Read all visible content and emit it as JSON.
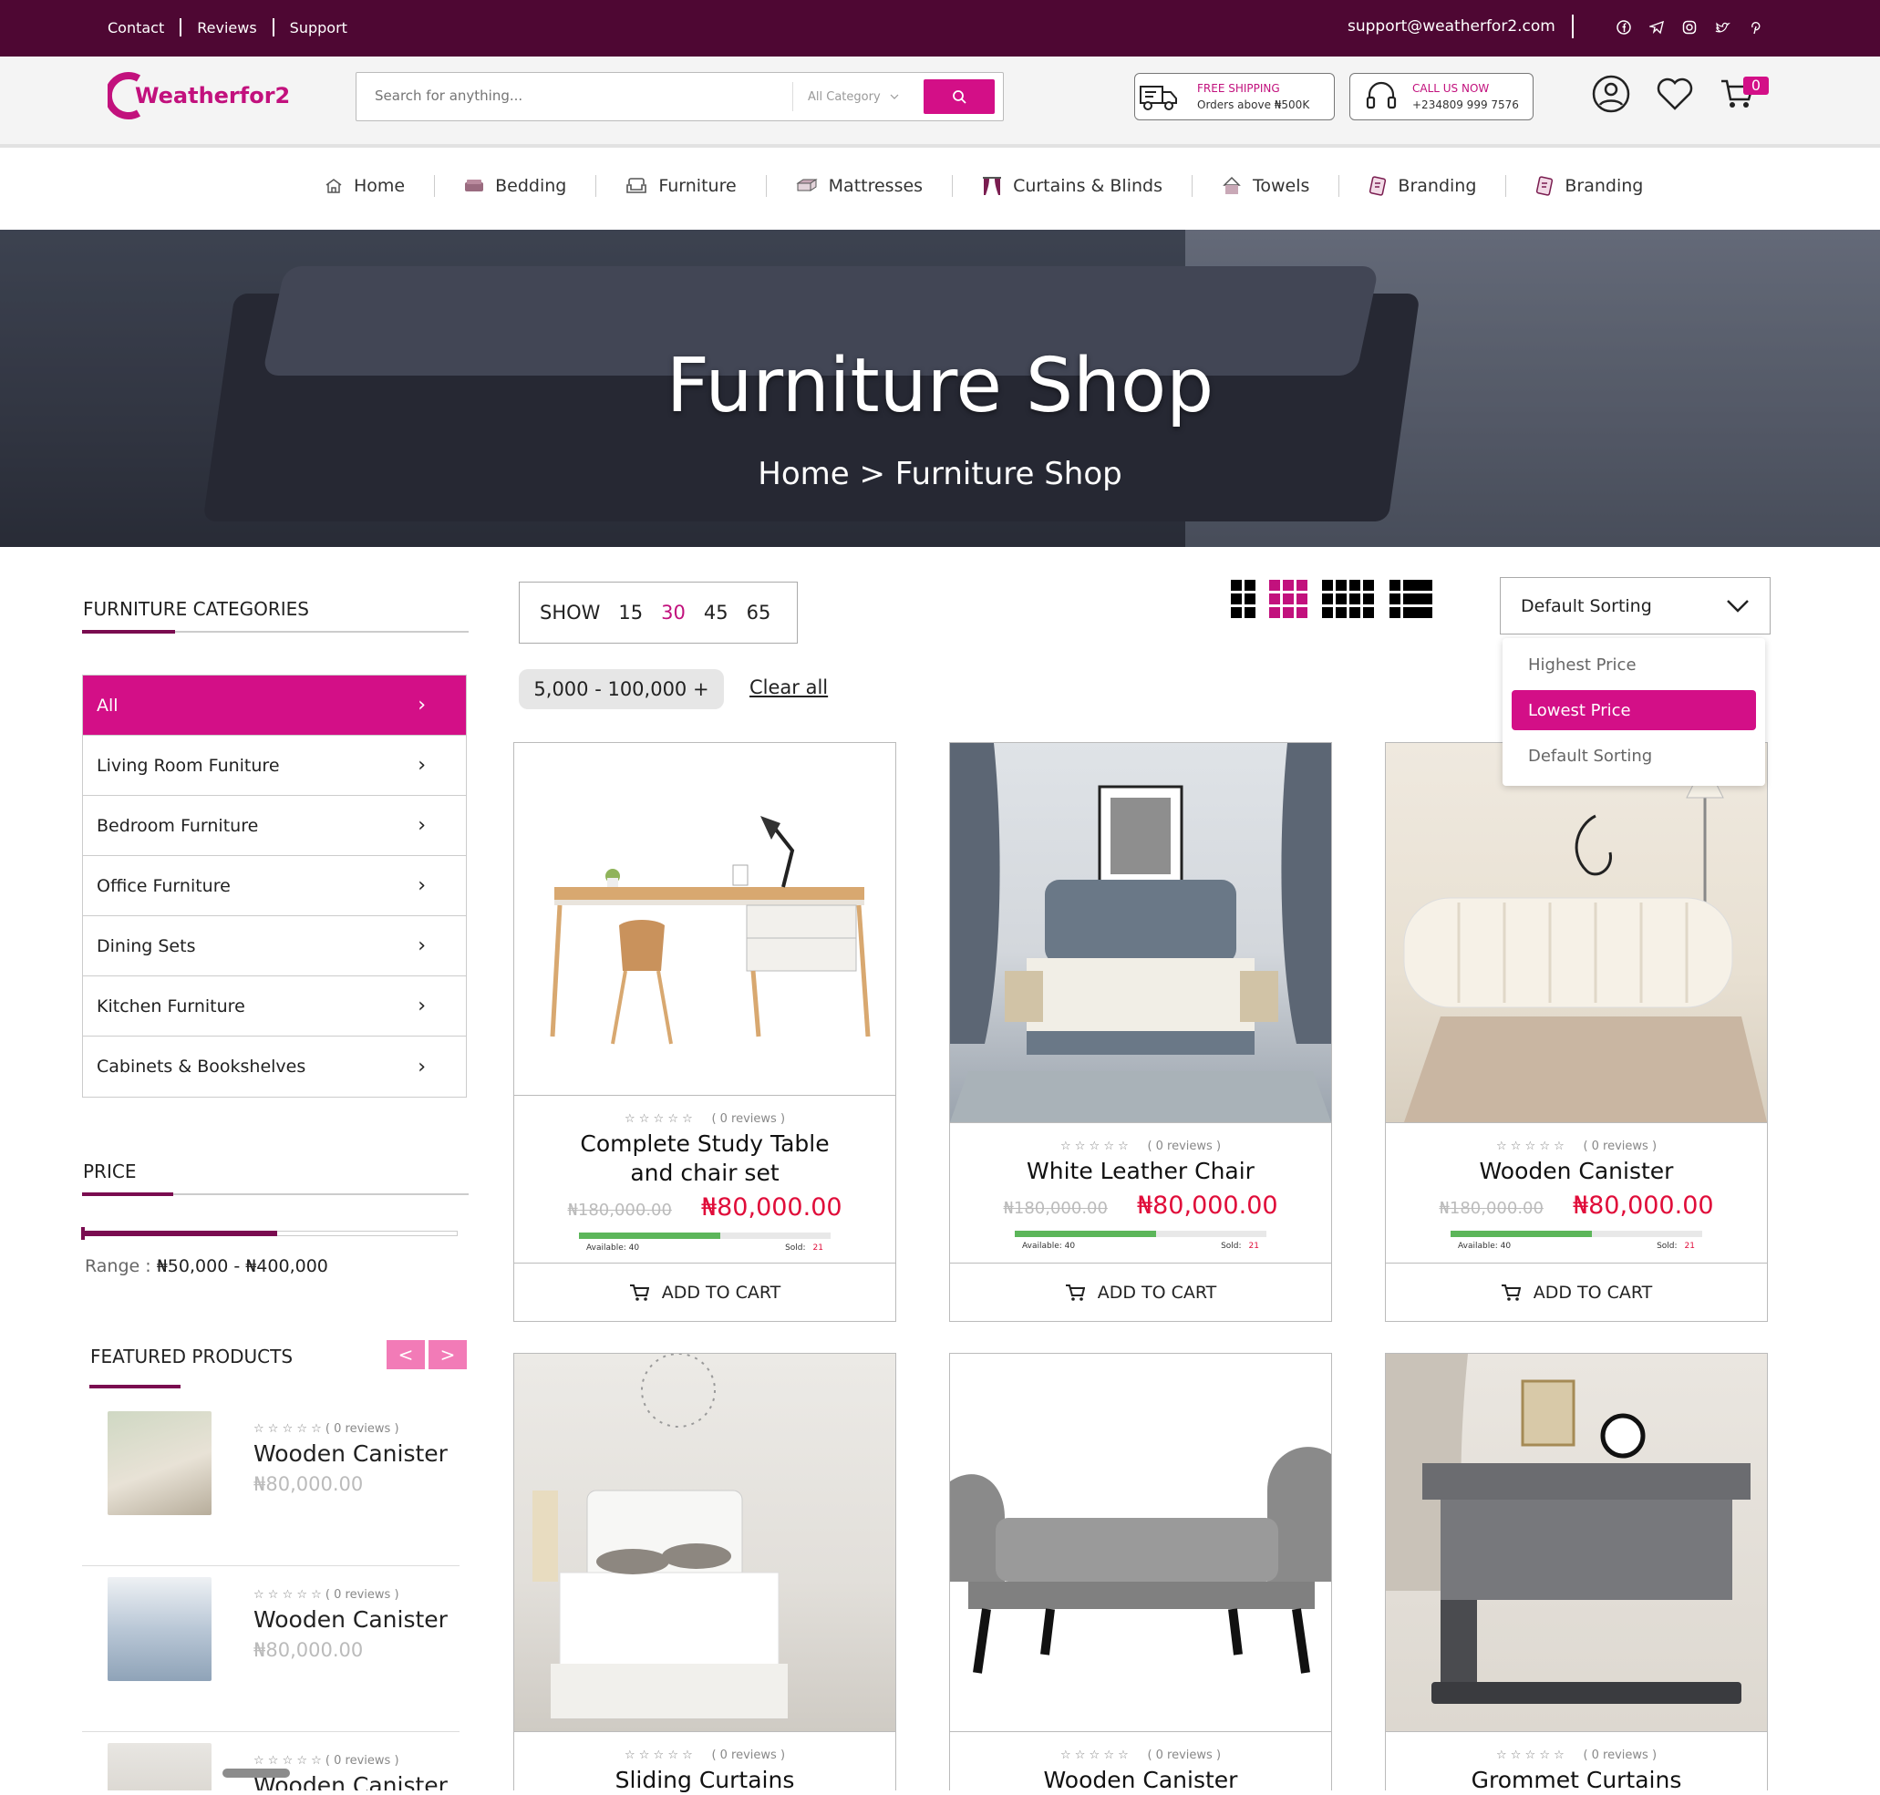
{
  "topbar": {
    "links": [
      "Contact",
      "Reviews",
      "Support"
    ],
    "email": "support@weatherfor2.com",
    "socials": [
      "facebook-icon",
      "telegram-icon",
      "instagram-icon",
      "twitter-icon",
      "pinterest-icon"
    ]
  },
  "header": {
    "logo": "Weatherfor2",
    "search_placeholder": "Search for anything...",
    "category": "All Category",
    "shipping": {
      "title": "FREE SHIPPING",
      "subtitle": "Orders above ₦500K"
    },
    "call": {
      "title": "CALL US NOW",
      "subtitle": "+234809 999 7576"
    },
    "cart_count": "0"
  },
  "nav": [
    {
      "label": "Home",
      "icon": "home-icon"
    },
    {
      "label": "Bedding",
      "icon": "bedding-icon"
    },
    {
      "label": "Furniture",
      "icon": "sofa-icon"
    },
    {
      "label": "Mattresses",
      "icon": "mattress-icon"
    },
    {
      "label": "Curtains & Blinds",
      "icon": "curtain-icon"
    },
    {
      "label": "Towels",
      "icon": "towel-icon"
    },
    {
      "label": "Branding",
      "icon": "branding-icon"
    },
    {
      "label": "Branding",
      "icon": "branding-icon"
    }
  ],
  "hero": {
    "title": "Furniture Shop",
    "breadcrumb": "Home > Furniture Shop"
  },
  "sidebar": {
    "categories_title": "FURNITURE CATEGORIES",
    "categories": [
      "All",
      "Living Room Funiture",
      "Bedroom Furniture",
      "Office Furniture",
      "Dining Sets",
      "Kitchen Furniture",
      "Cabinets & Bookshelves"
    ],
    "price_title": "PRICE",
    "price_fill_fraction": 0.52,
    "range_label": "Range :",
    "range_value": "₦50,000 - ₦400,000",
    "featured_title": "FEATURED PRODUCTS",
    "featured_prev": "<",
    "featured_next": ">",
    "featured": [
      {
        "stars": "☆ ☆ ☆ ☆ ☆ ( 0 reviews )",
        "name": "Wooden Canister",
        "price": "₦80,000.00"
      },
      {
        "stars": "☆ ☆ ☆ ☆ ☆ ( 0 reviews )",
        "name": "Wooden Canister",
        "price": "₦80,000.00"
      },
      {
        "stars": "☆ ☆ ☆ ☆ ☆ ( 0 reviews )",
        "name": "Wooden Canister",
        "price": ""
      }
    ]
  },
  "toolbar": {
    "show_label": "SHOW",
    "show_options": [
      "15",
      "30",
      "45",
      "65"
    ],
    "show_selected": "30",
    "filter_chip": "5,000 - 100,000 +",
    "clear_all": "Clear all",
    "sort_selected": "Default Sorting",
    "sort_options": [
      "Highest Price",
      "Lowest Price",
      "Default Sorting"
    ],
    "sort_highlighted": "Lowest Price"
  },
  "products": [
    {
      "stars": "☆ ☆ ☆ ☆ ☆",
      "reviews": "( 0 reviews )",
      "name": "Complete Study Table and chair set",
      "old_price": "₦180,000.00",
      "price": "₦80,000.00",
      "available_label": "Available:",
      "available": "40",
      "sold_label": "Sold:",
      "sold": "21",
      "stock_fraction": 0.56,
      "cart": "ADD TO CART"
    },
    {
      "stars": "☆ ☆ ☆ ☆ ☆",
      "reviews": "( 0 reviews )",
      "name": "White Leather Chair",
      "old_price": "₦180,000.00",
      "price": "₦80,000.00",
      "available_label": "Available:",
      "available": "40",
      "sold_label": "Sold:",
      "sold": "21",
      "stock_fraction": 0.56,
      "cart": "ADD TO CART"
    },
    {
      "stars": "☆ ☆ ☆ ☆ ☆",
      "reviews": "( 0 reviews )",
      "name": "Wooden Canister",
      "old_price": "₦180,000.00",
      "price": "₦80,000.00",
      "available_label": "Available:",
      "available": "40",
      "sold_label": "Sold:",
      "sold": "21",
      "stock_fraction": 0.56,
      "cart": "ADD TO CART"
    },
    {
      "stars": "☆ ☆ ☆ ☆ ☆",
      "reviews": "( 0 reviews )",
      "name": "Sliding Curtains"
    },
    {
      "stars": "☆ ☆ ☆ ☆ ☆",
      "reviews": "( 0 reviews )",
      "name": "Wooden Canister"
    },
    {
      "stars": "☆ ☆ ☆ ☆ ☆",
      "reviews": "( 0 reviews )",
      "name": "Grommet Curtains"
    }
  ],
  "colors": {
    "brand": "#4e0733",
    "accent": "#d30f87",
    "price_red": "#e00d3a",
    "stock_green": "#5cb65a"
  }
}
